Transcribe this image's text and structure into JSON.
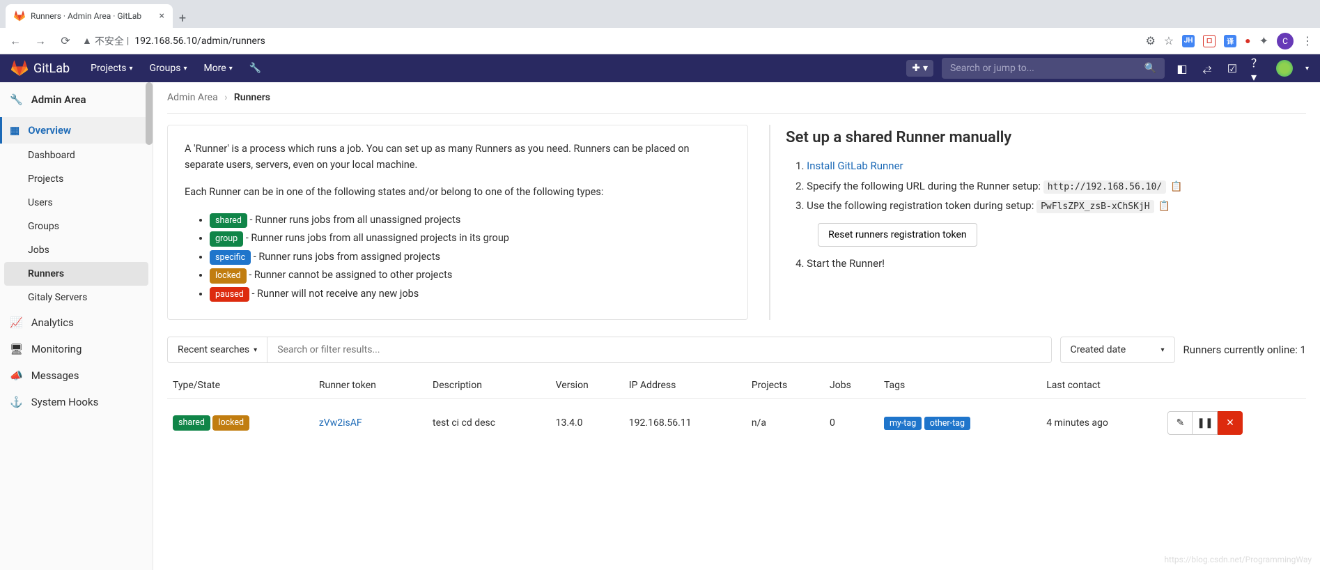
{
  "browser": {
    "tab_title": "Runners · Admin Area · GitLab",
    "url_warn": "不安全",
    "url": "192.168.56.10/admin/runners"
  },
  "header": {
    "brand": "GitLab",
    "nav": {
      "projects": "Projects",
      "groups": "Groups",
      "more": "More"
    },
    "search_placeholder": "Search or jump to..."
  },
  "sidebar": {
    "title": "Admin Area",
    "overview": "Overview",
    "items": {
      "dashboard": "Dashboard",
      "projects": "Projects",
      "users": "Users",
      "groups": "Groups",
      "jobs": "Jobs",
      "runners": "Runners",
      "gitaly": "Gitaly Servers"
    },
    "analytics": "Analytics",
    "monitoring": "Monitoring",
    "messages": "Messages",
    "hooks": "System Hooks"
  },
  "breadcrumb": {
    "admin": "Admin Area",
    "current": "Runners"
  },
  "intro": {
    "p1": "A 'Runner' is a process which runs a job. You can set up as many Runners as you need. Runners can be placed on separate users, servers, even on your local machine.",
    "p2": "Each Runner can be in one of the following states and/or belong to one of the following types:",
    "li_shared": " - Runner runs jobs from all unassigned projects",
    "li_group": " - Runner runs jobs from all unassigned projects in its group",
    "li_specific": " - Runner runs jobs from assigned projects",
    "li_locked": " - Runner cannot be assigned to other projects",
    "li_paused": " - Runner will not receive any new jobs",
    "b_shared": "shared",
    "b_group": "group",
    "b_specific": "specific",
    "b_locked": "locked",
    "b_paused": "paused"
  },
  "setup": {
    "title": "Set up a shared Runner manually",
    "install": "Install GitLab Runner",
    "step2_pre": "Specify the following URL during the Runner setup: ",
    "url": "http://192.168.56.10/",
    "step3_pre": "Use the following registration token during setup: ",
    "token": "PwFlsZPX_zsB-xChSKjH",
    "reset": "Reset runners registration token",
    "step4": "Start the Runner!"
  },
  "filter": {
    "recent": "Recent searches",
    "placeholder": "Search or filter results...",
    "sort": "Created date",
    "online": "Runners currently online: 1"
  },
  "table": {
    "h_type": "Type/State",
    "h_token": "Runner token",
    "h_desc": "Description",
    "h_ver": "Version",
    "h_ip": "IP Address",
    "h_proj": "Projects",
    "h_jobs": "Jobs",
    "h_tags": "Tags",
    "h_last": "Last contact"
  },
  "row": {
    "badge1": "shared",
    "badge2": "locked",
    "token": "zVw2isAF",
    "desc": "test ci cd desc",
    "ver": "13.4.0",
    "ip": "192.168.56.11",
    "proj": "n/a",
    "jobs": "0",
    "tag1": "my-tag",
    "tag2": "other-tag",
    "last": "4 minutes ago"
  },
  "watermark": "https://blog.csdn.net/ProgrammingWay"
}
